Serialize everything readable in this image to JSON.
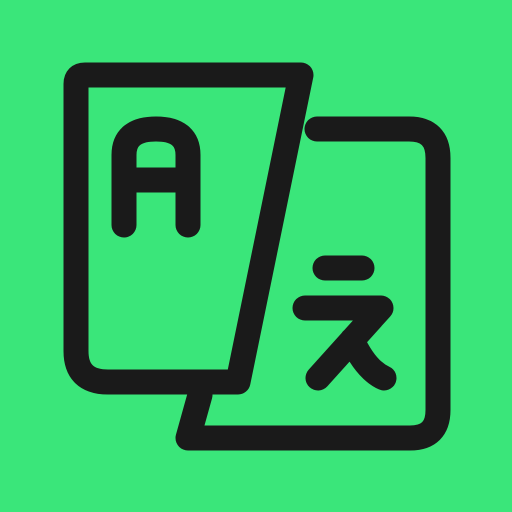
{
  "icon": {
    "name": "translate-icon",
    "glyph_latin": "A",
    "glyph_japanese": "え"
  },
  "colors": {
    "background": "#3ae67a",
    "stroke": "#1a1a1a"
  }
}
